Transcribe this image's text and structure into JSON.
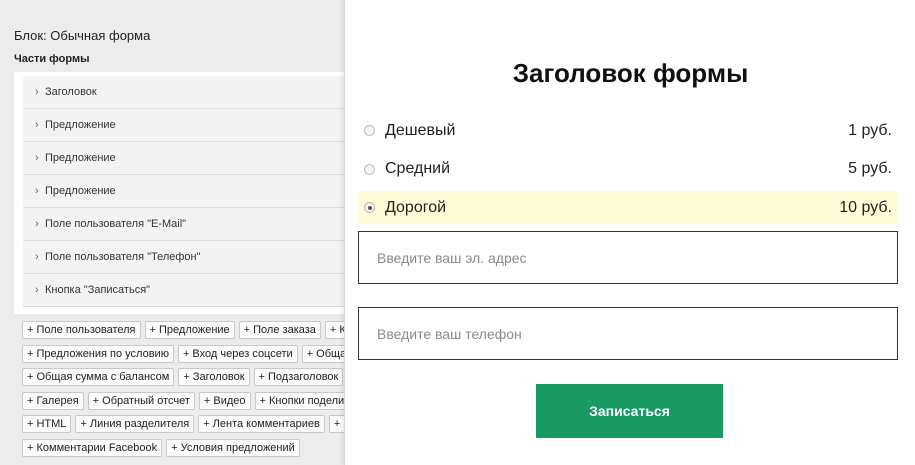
{
  "editor": {
    "block_title": "Блок: Обычная форма",
    "parts_label": "Части формы",
    "parts": [
      "Заголовок",
      "Предложение",
      "Предложение",
      "Предложение",
      "Поле пользователя \"E-Mail\"",
      "Поле пользователя \"Телефон\"",
      "Кнопка \"Записаться\""
    ],
    "add_buttons": [
      [
        "+ Поле пользователя",
        "+ Предложение",
        "+ Поле заказа",
        "+ К"
      ],
      [
        "+ Предложения по условию",
        "+ Вход через соцсети",
        "+ Общая"
      ],
      [
        "+ Общая сумма с балансом",
        "+ Заголовок",
        "+ Подзаголовок"
      ],
      [
        "+ Галерея",
        "+ Обратный отсчет",
        "+ Видео",
        "+ Кнопки поделит"
      ],
      [
        "+ HTML",
        "+ Линия разделителя",
        "+ Лента комментариев",
        "+ К"
      ],
      [
        "+ Комментарии Facebook",
        "+ Условия предложений"
      ]
    ]
  },
  "preview": {
    "title": "Заголовок формы",
    "options": [
      {
        "label": "Дешевый",
        "price": "1 руб.",
        "selected": false
      },
      {
        "label": "Средний",
        "price": "5 руб.",
        "selected": false
      },
      {
        "label": "Дорогой",
        "price": "10 руб.",
        "selected": true
      }
    ],
    "email_placeholder": "Введите ваш эл. адрес",
    "phone_placeholder": "Введите ваш телефон",
    "submit_label": "Записаться"
  },
  "colors": {
    "submit_bg": "#1a9a63",
    "selected_option_bg": "#fefbd6"
  }
}
